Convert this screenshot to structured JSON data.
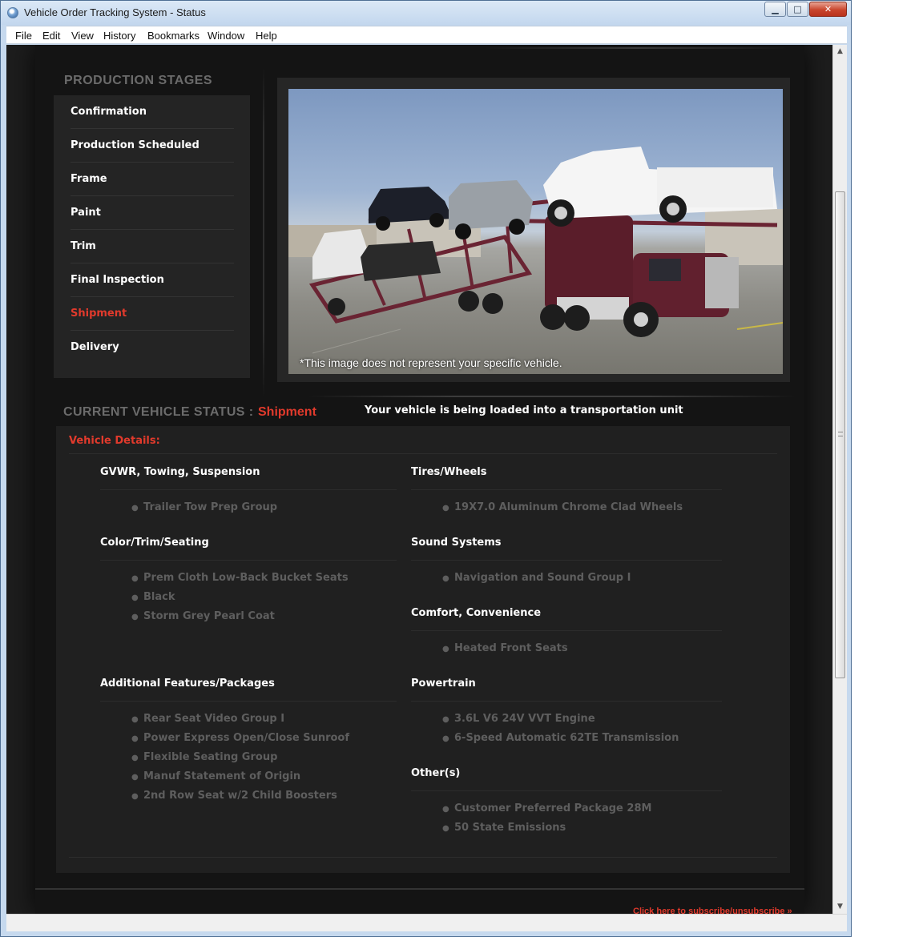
{
  "window": {
    "title": "Vehicle Order Tracking System - Status",
    "controls": {
      "minimize": "▁",
      "maximize": "□",
      "close": "✕"
    }
  },
  "menu": [
    "File",
    "Edit",
    "View",
    "History",
    "Bookmarks",
    "Window",
    "Help"
  ],
  "stages": {
    "title": "PRODUCTION STAGES",
    "items": [
      "Confirmation",
      "Production Scheduled",
      "Frame",
      "Paint",
      "Trim",
      "Final Inspection",
      "Shipment",
      "Delivery"
    ],
    "active": "Shipment"
  },
  "photo": {
    "caption": "*This image does not represent your specific vehicle."
  },
  "status": {
    "label": "CURRENT VEHICLE STATUS :",
    "value": "Shipment",
    "message": "Your vehicle is being loaded into a transportation unit"
  },
  "details": {
    "title": "Vehicle Details:",
    "groups": {
      "gvwr": {
        "heading": "GVWR, Towing, Suspension",
        "items": [
          "Trailer Tow Prep Group"
        ]
      },
      "tires": {
        "heading": "Tires/Wheels",
        "items": [
          "19X7.0 Aluminum Chrome Clad Wheels"
        ]
      },
      "color": {
        "heading": "Color/Trim/Seating",
        "items": [
          "Prem Cloth Low-Back Bucket Seats",
          "Black",
          "Storm Grey Pearl Coat"
        ]
      },
      "sound": {
        "heading": "Sound Systems",
        "items": [
          "Navigation and Sound Group I"
        ]
      },
      "comfort": {
        "heading": "Comfort, Convenience",
        "items": [
          "Heated Front Seats"
        ]
      },
      "additional": {
        "heading": "Additional Features/Packages",
        "items": [
          "Rear Seat Video Group I",
          "Power Express Open/Close Sunroof",
          "Flexible Seating Group",
          "Manuf Statement of Origin",
          "2nd Row Seat w/2 Child Boosters"
        ]
      },
      "powertrain": {
        "heading": "Powertrain",
        "items": [
          "3.6L V6 24V VVT Engine",
          "6-Speed Automatic 62TE Transmission"
        ]
      },
      "others": {
        "heading": "Other(s)",
        "items": [
          "Customer Preferred Package 28M",
          "50 State Emissions"
        ]
      }
    }
  },
  "footer": {
    "link": "Click here to subscribe/unsubscribe »"
  },
  "colors": {
    "accent": "#e13a2c",
    "panel": "#202020",
    "page": "#141414",
    "muted_text": "#5e5e5e"
  },
  "icons": {
    "bullet": "●",
    "scroll_up": "▲",
    "scroll_down": "▼"
  }
}
